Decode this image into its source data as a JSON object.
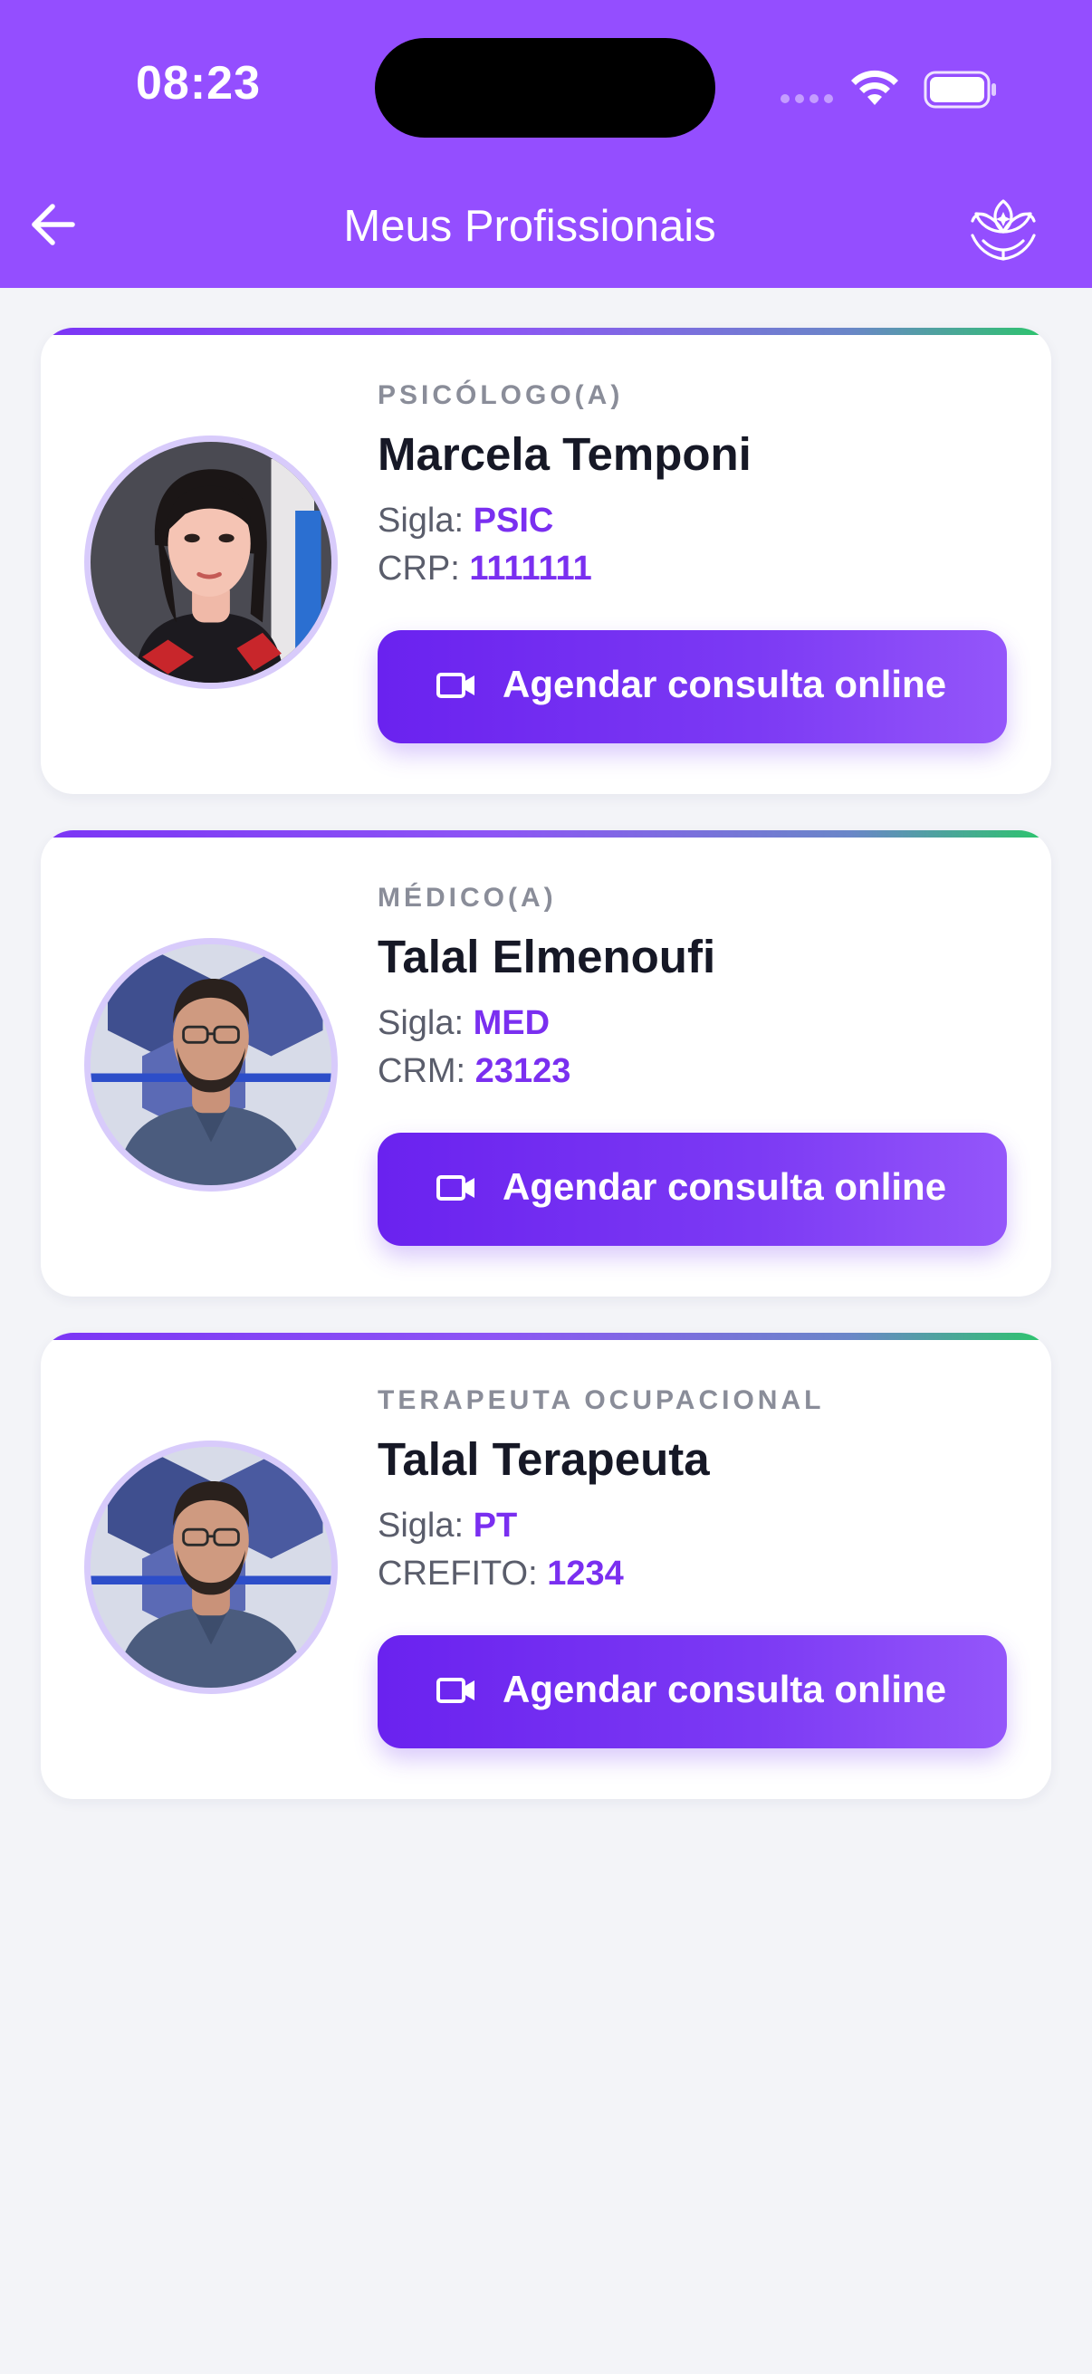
{
  "status_bar": {
    "time": "08:23"
  },
  "header": {
    "title": "Meus Profissionais"
  },
  "colors": {
    "header_bg": "#944eff",
    "accent": "#7a2ff0",
    "button": "#6a22ef",
    "bar_start": "#7b35f5",
    "bar_end": "#2bc66a",
    "page_bg": "#f3f4f8"
  },
  "icons": {
    "back": "arrow-left-icon",
    "logo": "lotus-hands-logo",
    "video": "video-camera-icon"
  },
  "professionals": [
    {
      "role": "PSICÓLOGO(A)",
      "name": "Marcela Temponi",
      "sigla_label": "Sigla:",
      "sigla": "PSIC",
      "registry_label": "CRP:",
      "registry": "1111111",
      "button_label": "Agendar consulta online"
    },
    {
      "role": "MÉDICO(A)",
      "name": "Talal Elmenoufi",
      "sigla_label": "Sigla:",
      "sigla": "MED",
      "registry_label": "CRM:",
      "registry": "23123",
      "button_label": "Agendar consulta online"
    },
    {
      "role": "TERAPEUTA OCUPACIONAL",
      "name": "Talal Terapeuta",
      "sigla_label": "Sigla:",
      "sigla": "PT",
      "registry_label": "CREFITO:",
      "registry": "1234",
      "button_label": "Agendar consulta online"
    }
  ]
}
